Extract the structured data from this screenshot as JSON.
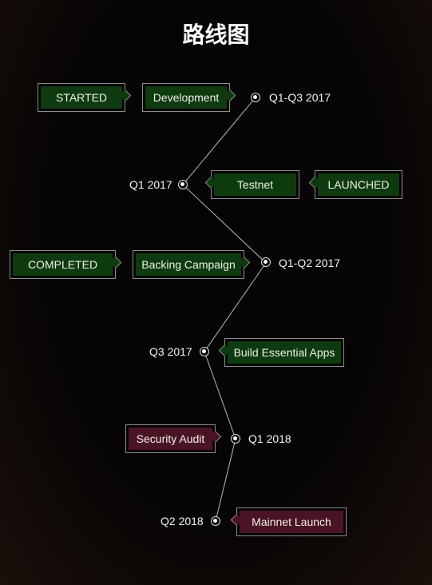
{
  "title": "路线图",
  "milestones": [
    {
      "date": "Q1-Q3 2017",
      "tags": [
        {
          "label": "STARTED",
          "color": "green"
        },
        {
          "label": "Development",
          "color": "green"
        }
      ]
    },
    {
      "date": "Q1 2017",
      "tags": [
        {
          "label": "Testnet",
          "color": "green"
        },
        {
          "label": "LAUNCHED",
          "color": "green"
        }
      ]
    },
    {
      "date": "Q1-Q2 2017",
      "tags": [
        {
          "label": "COMPLETED",
          "color": "green"
        },
        {
          "label": "Backing Campaign",
          "color": "green"
        }
      ]
    },
    {
      "date": "Q3 2017",
      "tags": [
        {
          "label": "Build Essential Apps",
          "color": "green"
        }
      ]
    },
    {
      "date": "Q1 2018",
      "tags": [
        {
          "label": "Security Audit",
          "color": "maroon"
        }
      ]
    },
    {
      "date": "Q2 2018",
      "tags": [
        {
          "label": "Mainnet Launch",
          "color": "maroon"
        }
      ]
    }
  ],
  "colors": {
    "green": "#0e3a0f",
    "maroon": "#4a1424",
    "border": "#8c8c8c"
  }
}
